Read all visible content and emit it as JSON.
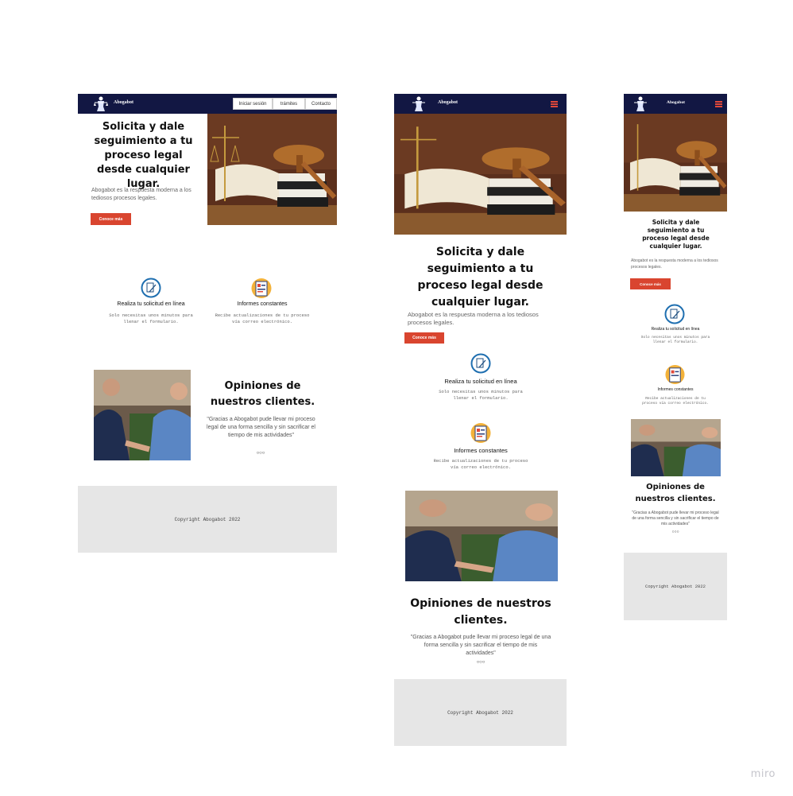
{
  "brand": "Abogabot",
  "nav": {
    "login": "Iniciar sesión",
    "tramites": "trámites",
    "contacto": "Contacto"
  },
  "hero": {
    "title": "Solicita y dale seguimiento a tu proceso legal desde cualquier lugar.",
    "text": "Abogabot es la respuesta moderna a los tediosos procesos legales.",
    "cta": "Conoce más"
  },
  "features": [
    {
      "title": "Realiza tu solicitud en línea",
      "desc": "Solo necesitas unos minutos para llenar el formulario.",
      "icon": "document-pen-icon"
    },
    {
      "title": "Informes constantes",
      "desc": "Recibe actualizaciones de tu proceso vía correo electrónico.",
      "icon": "report-chart-icon"
    }
  ],
  "testimonials": {
    "title": "Opiniones de nuestros clientes.",
    "quote": "\"Gracias a Abogabot pude llevar mi proceso legal de una forma sencilla y sin sacrificar el tiempo de mis actividades\"",
    "dots": "○○○"
  },
  "footer": {
    "copyright": "Copyright Abogabot 2022"
  },
  "watermark": "miro",
  "colors": {
    "nav": "#121743",
    "accent": "#d9452f",
    "footer": "#e6e6e6",
    "icon_ring": "#1f6fb0"
  }
}
